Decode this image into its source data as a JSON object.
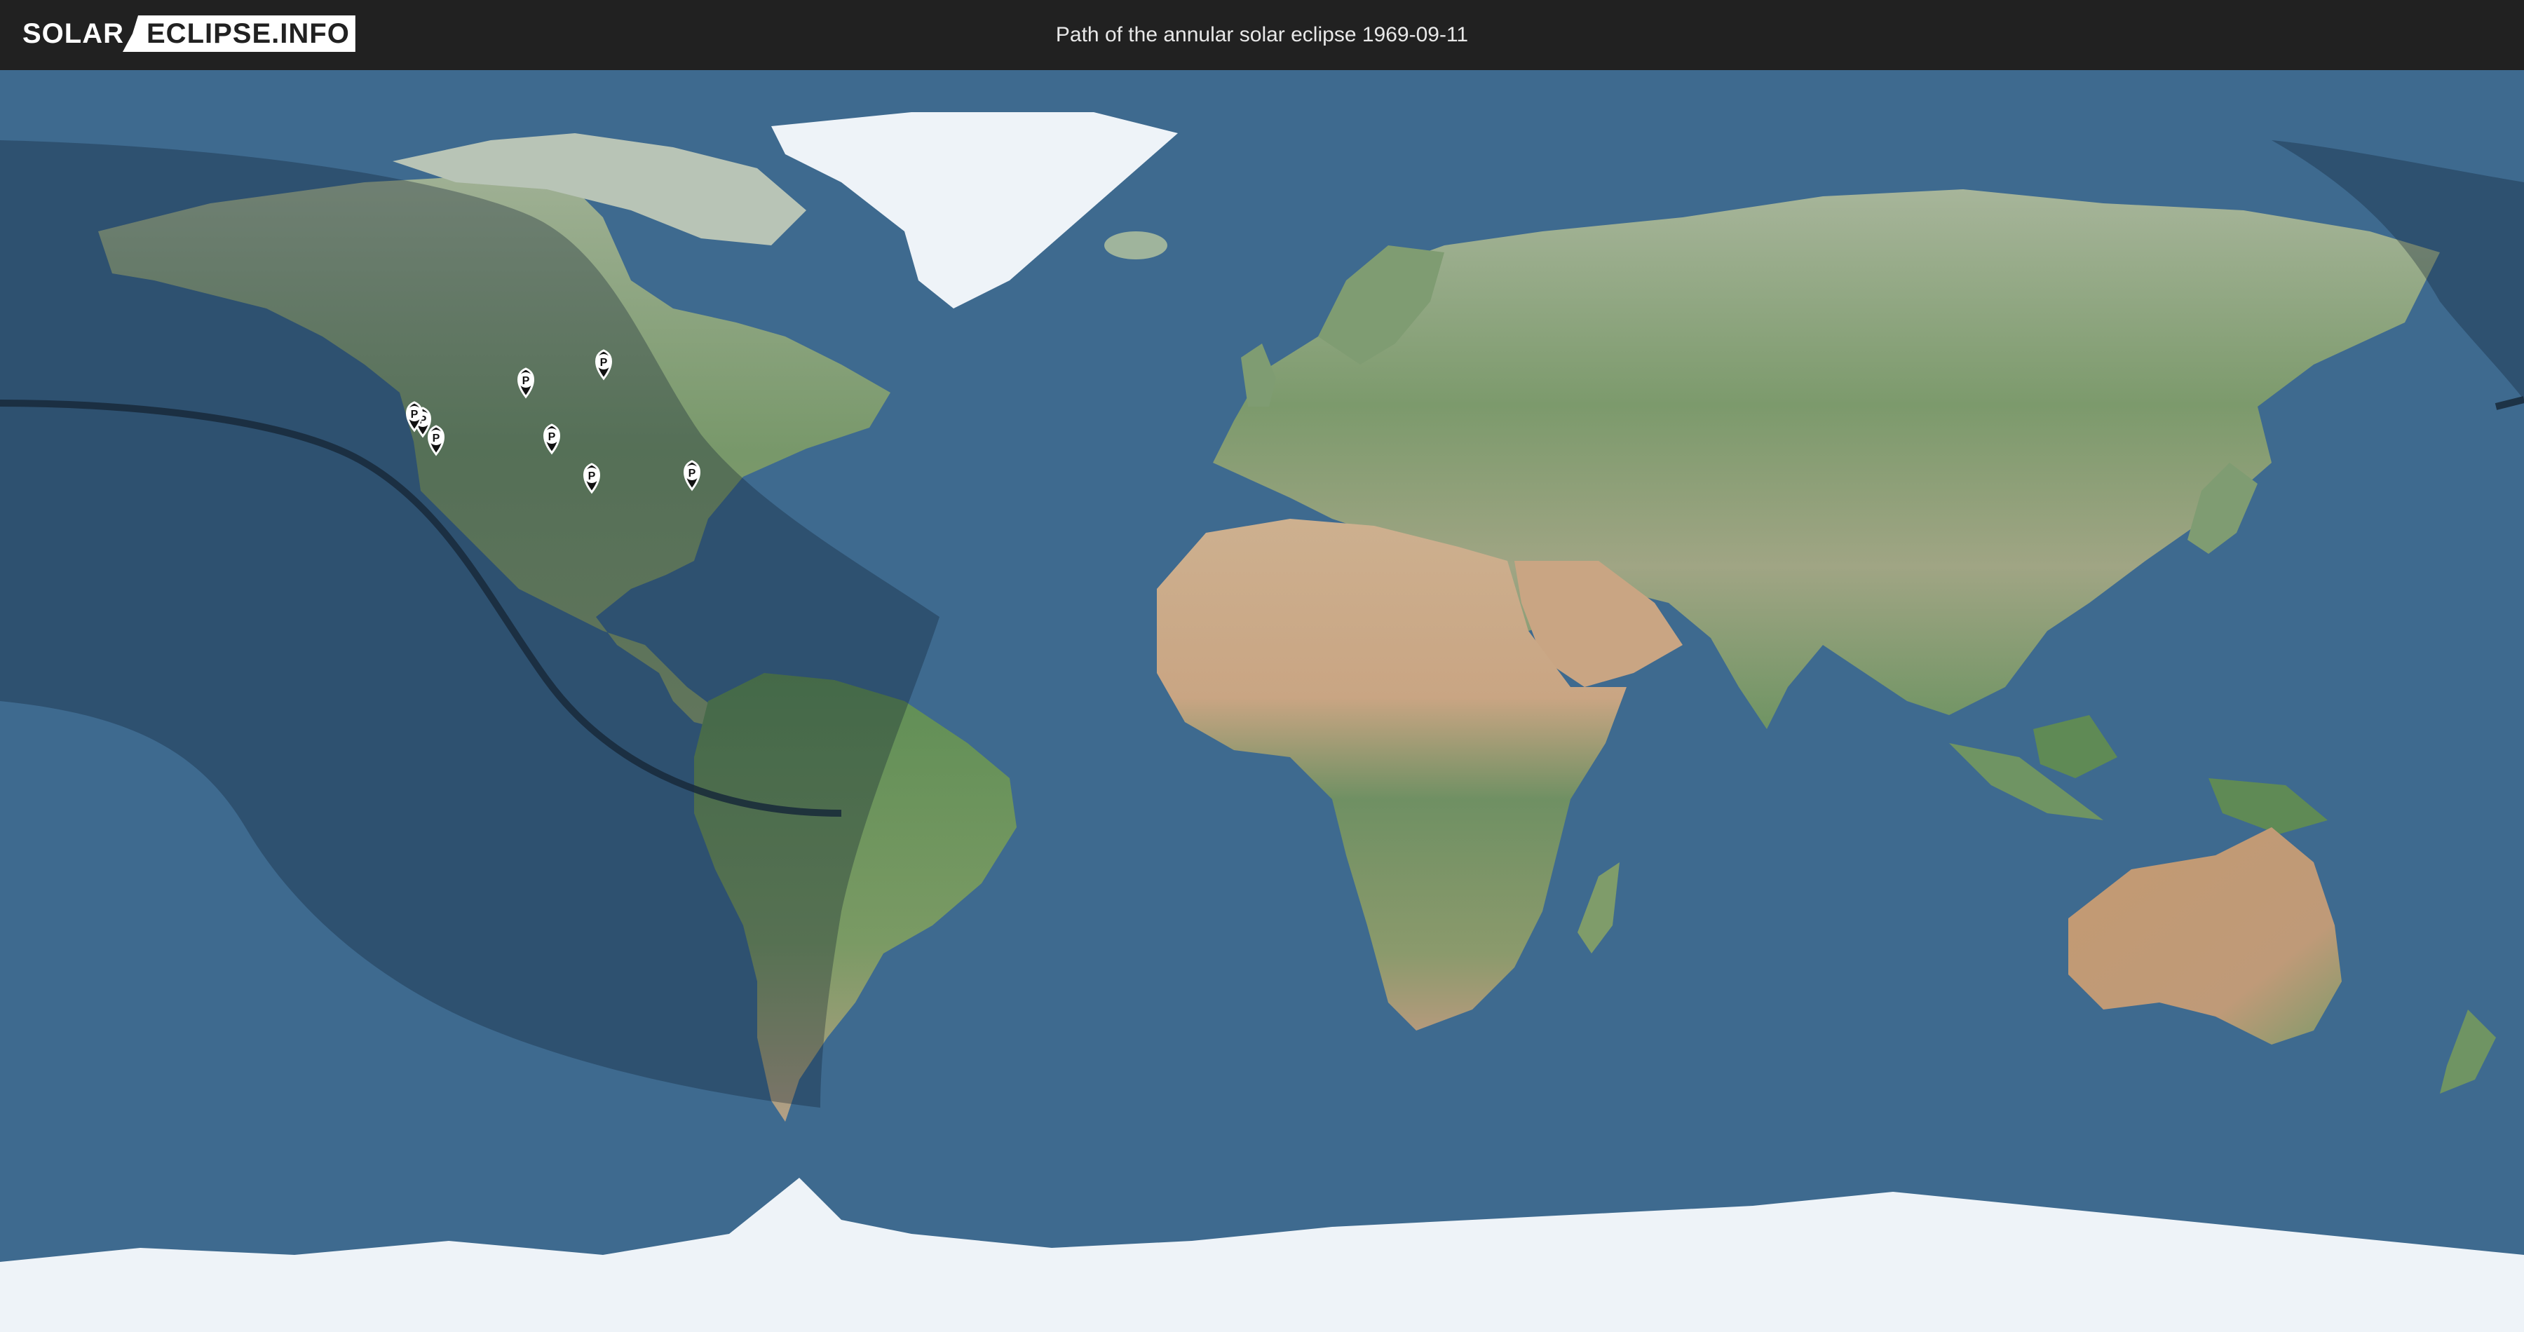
{
  "header": {
    "logo_left": "SOLAR",
    "logo_right": "ECLIPSE.INFO",
    "title": "Path of the annular solar eclipse 1969-09-11"
  },
  "markers": {
    "label": "P",
    "count": 8
  },
  "colors": {
    "ocean": "#3e6a8f",
    "header_bg": "#212121",
    "land_green": "#6f9466",
    "land_desert": "#c9a98a",
    "ice": "#eef3f8",
    "penumbra_shade": "#0b1d2e",
    "central_line": "#17293a"
  }
}
